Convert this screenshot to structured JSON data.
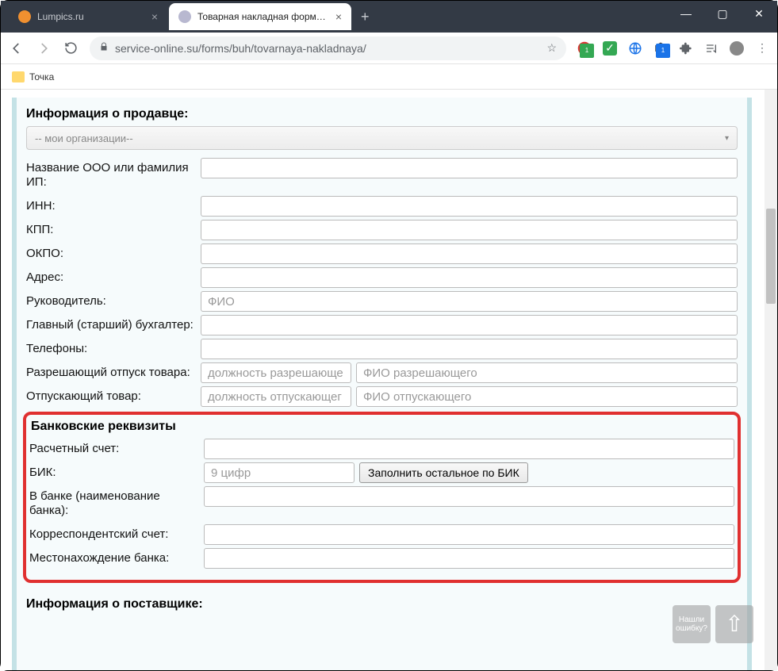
{
  "browser": {
    "tabs": [
      {
        "title": "Lumpics.ru",
        "favicon_color": "#f09030"
      },
      {
        "title": "Товарная накладная форма №",
        "favicon_color": "#b8b8d0"
      }
    ],
    "url": "service-online.su/forms/buh/tovarnaya-nakladnaya/",
    "bookmark": "Точка"
  },
  "seller": {
    "heading": "Информация о продавце:",
    "dropdown_placeholder": "-- мои организации--",
    "fields": {
      "name_label": "Название ООО или фамилия ИП:",
      "inn_label": "ИНН:",
      "kpp_label": "КПП:",
      "okpo_label": "ОКПО:",
      "address_label": "Адрес:",
      "head_label": "Руководитель:",
      "head_placeholder": "ФИО",
      "chief_acc_label": "Главный (старший) бухгалтер:",
      "phones_label": "Телефоны:",
      "release_auth_label": "Разрешающий отпуск товара:",
      "release_auth_pos_placeholder": "должность разрешающе",
      "release_auth_fio_placeholder": "ФИО разрешающего",
      "releaser_label": "Отпускающий товар:",
      "releaser_pos_placeholder": "должность отпускающег",
      "releaser_fio_placeholder": "ФИО отпускающего"
    }
  },
  "bank": {
    "heading": "Банковские реквизиты",
    "account_label": "Расчетный счет:",
    "bik_label": "БИК:",
    "bik_placeholder": "9 цифр",
    "fill_btn": "Заполнить остальное по БИК",
    "bank_name_label": "В банке (наименование банка):",
    "corr_label": "Корреспондентский счет:",
    "loc_label": "Местонахождение банка:"
  },
  "supplier": {
    "heading": "Информация о поставщике:"
  },
  "float": {
    "help": "Нашли ошибку?"
  }
}
